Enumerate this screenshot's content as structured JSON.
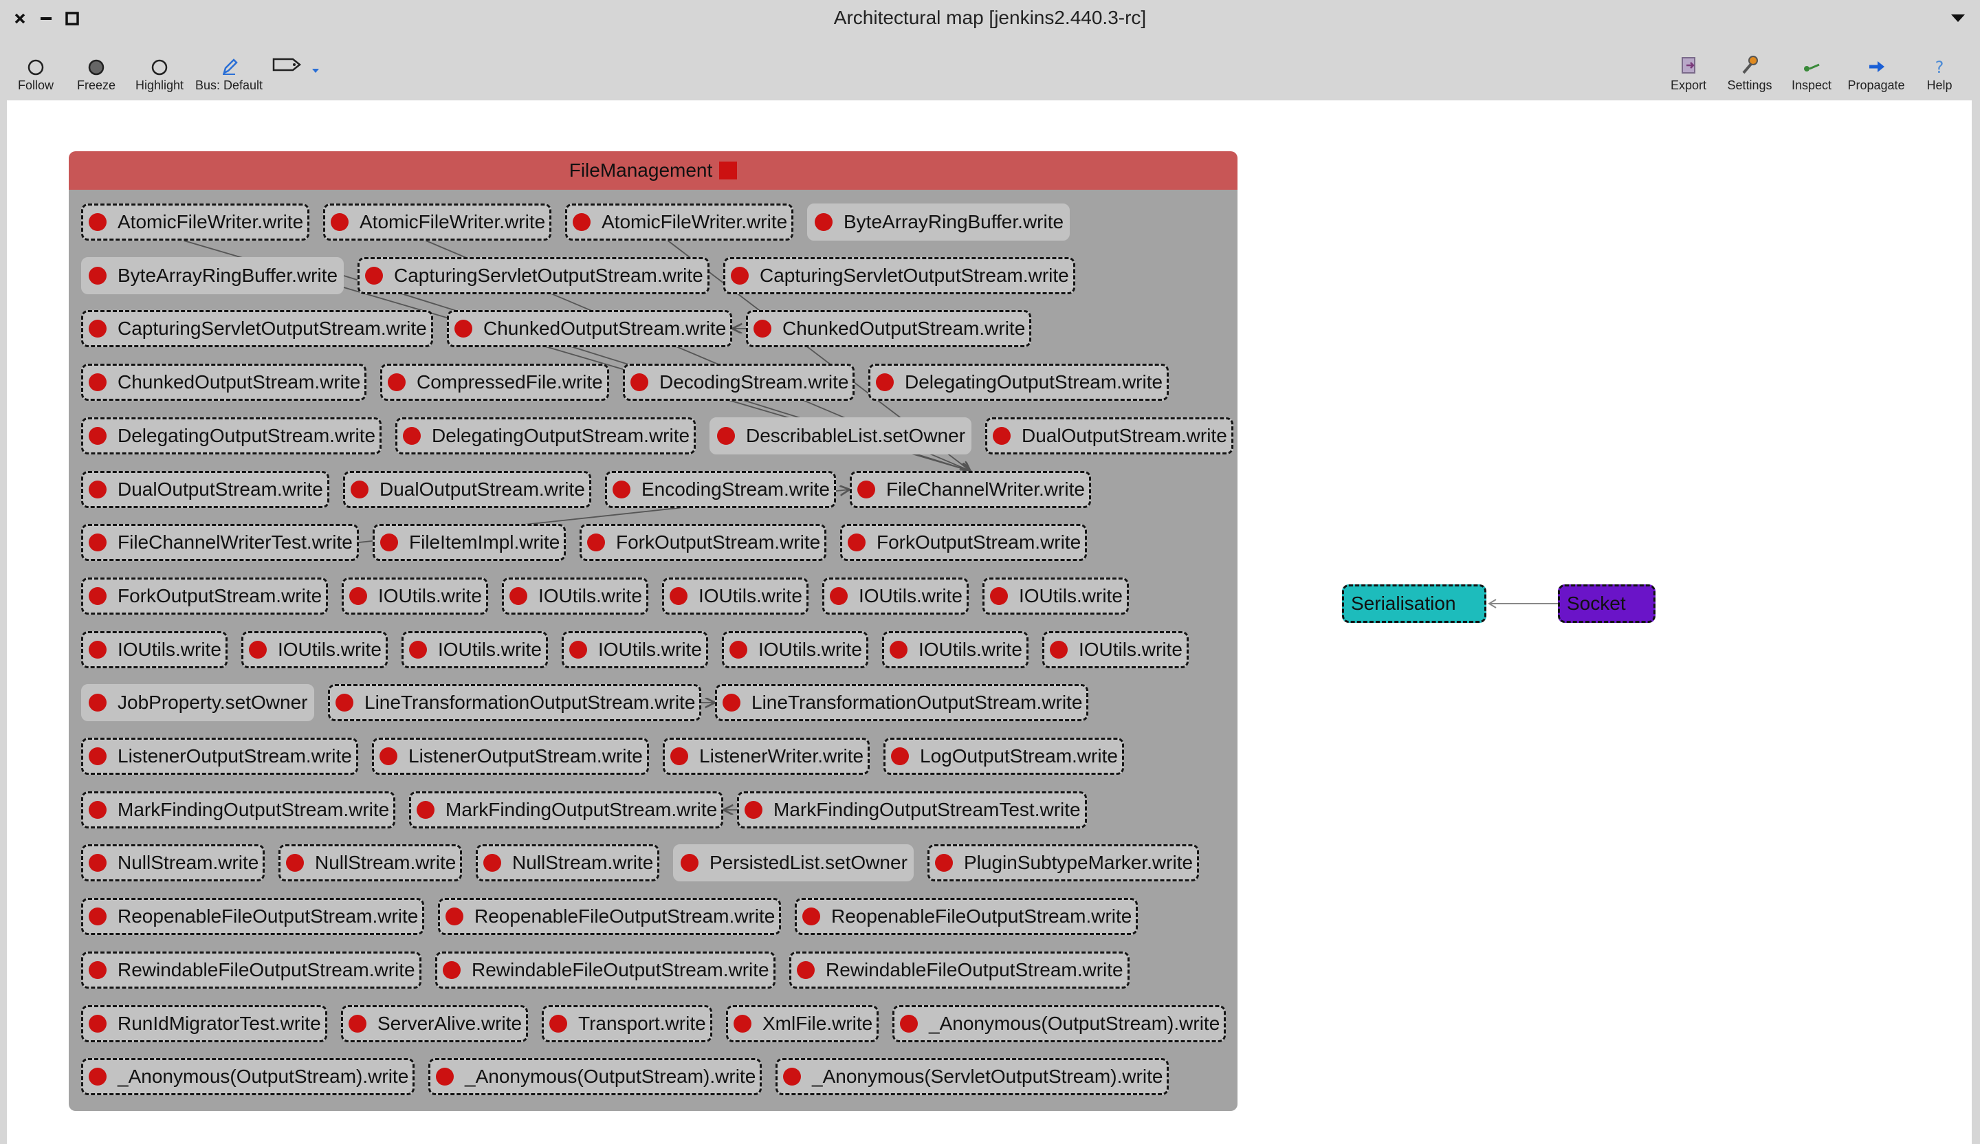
{
  "window": {
    "title": "Architectural map [jenkins2.440.3-rc]"
  },
  "toolbar": {
    "left": [
      {
        "label": "Follow",
        "icon": "circle-outline-icon"
      },
      {
        "label": "Freeze",
        "icon": "circle-filled-icon"
      },
      {
        "label": "Highlight",
        "icon": "circle-outline-icon"
      },
      {
        "label": "Bus: Default",
        "icon": "pencil-icon"
      },
      {
        "label": "",
        "icon": "tag-icon"
      }
    ],
    "right": [
      {
        "label": "Export",
        "icon": "export-icon"
      },
      {
        "label": "Settings",
        "icon": "wrench-icon"
      },
      {
        "label": "Inspect",
        "icon": "inspect-icon"
      },
      {
        "label": "Propagate",
        "icon": "arrow-right-icon"
      },
      {
        "label": "Help",
        "icon": "question-icon"
      }
    ]
  },
  "group": {
    "name": "FileManagement",
    "color": "#c85656"
  },
  "rows": [
    [
      {
        "label": "AtomicFileWriter.write"
      },
      {
        "label": "AtomicFileWriter.write"
      },
      {
        "label": "AtomicFileWriter.write"
      },
      {
        "label": "ByteArrayRingBuffer.write",
        "solid": true
      }
    ],
    [
      {
        "label": "ByteArrayRingBuffer.write",
        "solid": true
      },
      {
        "label": "CapturingServletOutputStream.write"
      },
      {
        "label": "CapturingServletOutputStream.write"
      }
    ],
    [
      {
        "label": "CapturingServletOutputStream.write"
      },
      {
        "label": "ChunkedOutputStream.write"
      },
      {
        "label": "ChunkedOutputStream.write"
      }
    ],
    [
      {
        "label": "ChunkedOutputStream.write"
      },
      {
        "label": "CompressedFile.write"
      },
      {
        "label": "DecodingStream.write"
      },
      {
        "label": "DelegatingOutputStream.write"
      }
    ],
    [
      {
        "label": "DelegatingOutputStream.write"
      },
      {
        "label": "DelegatingOutputStream.write"
      },
      {
        "label": "DescribableList.setOwner",
        "solid": true
      },
      {
        "label": "DualOutputStream.write"
      }
    ],
    [
      {
        "label": "DualOutputStream.write"
      },
      {
        "label": "DualOutputStream.write"
      },
      {
        "label": "EncodingStream.write"
      },
      {
        "label": "FileChannelWriter.write"
      }
    ],
    [
      {
        "label": "FileChannelWriterTest.write"
      },
      {
        "label": "FileItemImpl.write"
      },
      {
        "label": "ForkOutputStream.write"
      },
      {
        "label": "ForkOutputStream.write"
      }
    ],
    [
      {
        "label": "ForkOutputStream.write"
      },
      {
        "label": "IOUtils.write"
      },
      {
        "label": "IOUtils.write"
      },
      {
        "label": "IOUtils.write"
      },
      {
        "label": "IOUtils.write"
      },
      {
        "label": "IOUtils.write"
      }
    ],
    [
      {
        "label": "IOUtils.write"
      },
      {
        "label": "IOUtils.write"
      },
      {
        "label": "IOUtils.write"
      },
      {
        "label": "IOUtils.write"
      },
      {
        "label": "IOUtils.write"
      },
      {
        "label": "IOUtils.write"
      },
      {
        "label": "IOUtils.write"
      }
    ],
    [
      {
        "label": "JobProperty.setOwner",
        "solid": true
      },
      {
        "label": "LineTransformationOutputStream.write"
      },
      {
        "label": "LineTransformationOutputStream.write"
      }
    ],
    [
      {
        "label": "ListenerOutputStream.write"
      },
      {
        "label": "ListenerOutputStream.write"
      },
      {
        "label": "ListenerWriter.write"
      },
      {
        "label": "LogOutputStream.write"
      }
    ],
    [
      {
        "label": "MarkFindingOutputStream.write"
      },
      {
        "label": "MarkFindingOutputStream.write"
      },
      {
        "label": "MarkFindingOutputStreamTest.write"
      }
    ],
    [
      {
        "label": "NullStream.write"
      },
      {
        "label": "NullStream.write"
      },
      {
        "label": "NullStream.write"
      },
      {
        "label": "PersistedList.setOwner",
        "solid": true
      },
      {
        "label": "PluginSubtypeMarker.write"
      }
    ],
    [
      {
        "label": "ReopenableFileOutputStream.write"
      },
      {
        "label": "ReopenableFileOutputStream.write"
      },
      {
        "label": "ReopenableFileOutputStream.write"
      }
    ],
    [
      {
        "label": "RewindableFileOutputStream.write"
      },
      {
        "label": "RewindableFileOutputStream.write"
      },
      {
        "label": "RewindableFileOutputStream.write"
      }
    ],
    [
      {
        "label": "RunIdMigratorTest.write"
      },
      {
        "label": "ServerAlive.write"
      },
      {
        "label": "Transport.write"
      },
      {
        "label": "XmlFile.write"
      },
      {
        "label": "_Anonymous(OutputStream).write"
      }
    ],
    [
      {
        "label": "_Anonymous(OutputStream).write"
      },
      {
        "label": "_Anonymous(OutputStream).write"
      },
      {
        "label": "_Anonymous(ServletOutputStream).write"
      }
    ]
  ],
  "packages": [
    {
      "name": "Serialisation",
      "color": "#1dbcbc"
    },
    {
      "name": "Socket",
      "color": "#6a14c8"
    }
  ],
  "package_edges": [
    {
      "from": "Socket",
      "to": "Serialisation"
    }
  ]
}
